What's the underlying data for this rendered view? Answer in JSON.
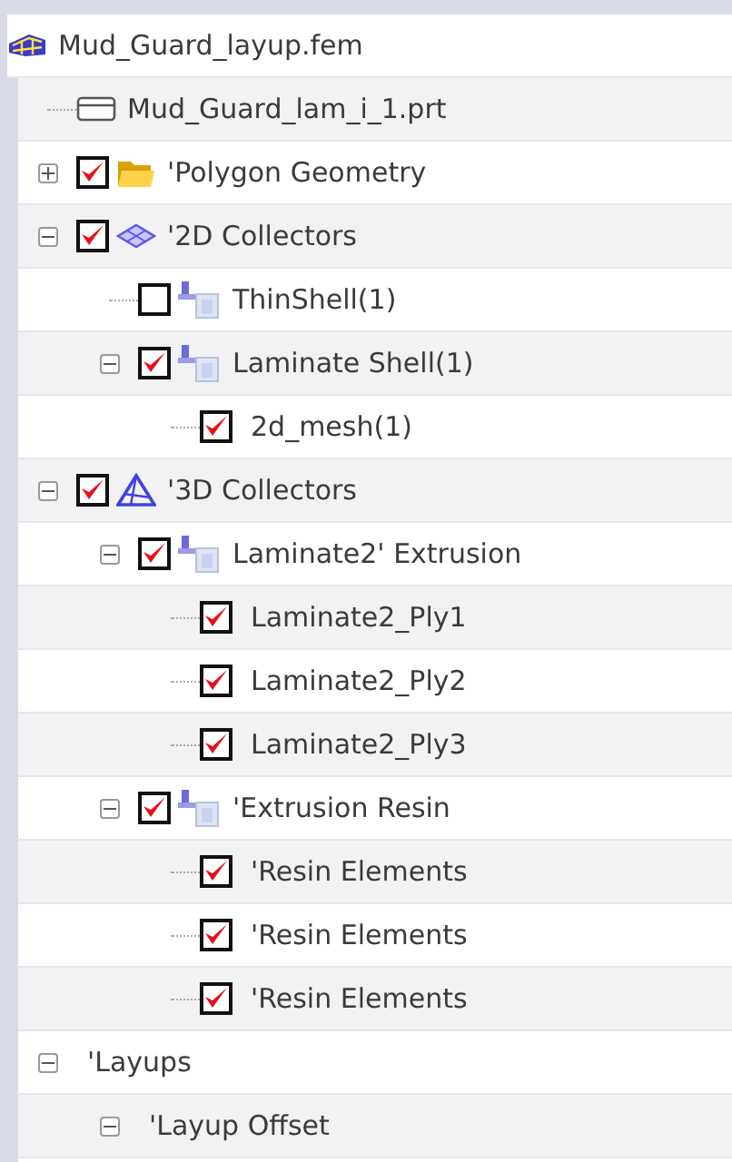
{
  "tree": {
    "label": "Mud_Guard_layup.fem",
    "kind": "fem",
    "children": [
      {
        "label": "Mud_Guard_lam_i_1.prt",
        "kind": "part"
      },
      {
        "label": "'Polygon Geometry",
        "kind": "folder",
        "checked": true,
        "expanded": false
      },
      {
        "label": "'2D Collectors",
        "kind": "collector_2d",
        "checked": true,
        "expanded": true,
        "children": [
          {
            "label": "ThinShell(1)",
            "kind": "collector",
            "checked": false
          },
          {
            "label": "Laminate Shell(1)",
            "kind": "collector",
            "checked": true,
            "expanded": true,
            "children": [
              {
                "label": "2d_mesh(1)",
                "checked": true
              }
            ]
          }
        ]
      },
      {
        "label": "'3D Collectors",
        "kind": "collector_3d",
        "checked": true,
        "expanded": true,
        "children": [
          {
            "label": "Laminate2' Extrusion",
            "kind": "collector",
            "checked": true,
            "expanded": true,
            "children": [
              {
                "label": "Laminate2_Ply1",
                "checked": true
              },
              {
                "label": "Laminate2_Ply2",
                "checked": true
              },
              {
                "label": "Laminate2_Ply3",
                "checked": true
              }
            ]
          },
          {
            "label": "'Extrusion Resin",
            "kind": "collector",
            "checked": true,
            "expanded": true,
            "children": [
              {
                "label": "'Resin Elements",
                "checked": true
              },
              {
                "label": "'Resin Elements",
                "checked": true
              },
              {
                "label": "'Resin Elements",
                "checked": true
              }
            ]
          }
        ]
      },
      {
        "label": "'Layups",
        "expanded": true,
        "children": [
          {
            "label": "'Layup Offset",
            "expanded": true
          }
        ]
      }
    ]
  }
}
